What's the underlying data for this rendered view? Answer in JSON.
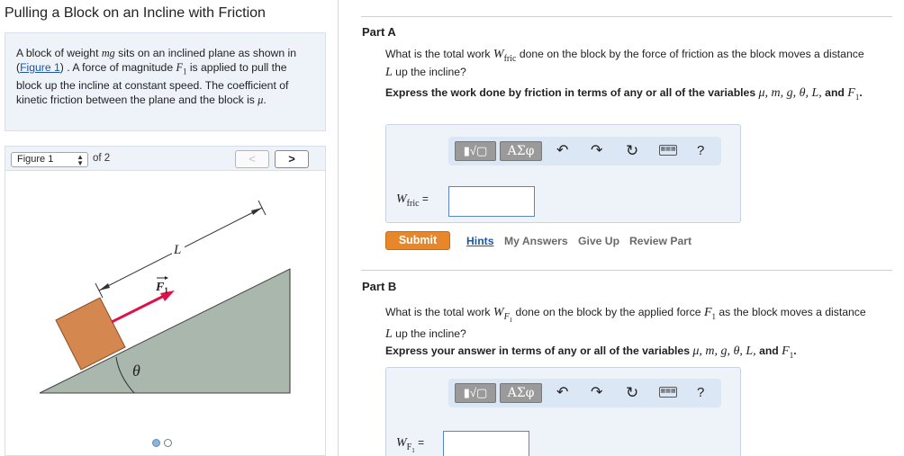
{
  "title": "Pulling a Block on an Incline with Friction",
  "problem": {
    "text_before_link": "A block of weight ",
    "weight_var": "mg",
    "text_mid1": " sits on an inclined plane as shown in (",
    "link": "Figure 1",
    "text_mid2": ") . A force of magnitude ",
    "force_var": "F",
    "force_sub": "1",
    "text_mid3": " is applied to pull the block up the incline at constant speed. The coefficient of kinetic friction between the plane and the block is ",
    "mu_var": "μ",
    "text_end": "."
  },
  "figure_nav": {
    "select_value": "Figure 1",
    "of_label": "of 2",
    "prev": "<",
    "next": ">"
  },
  "figure": {
    "label_L": "L",
    "label_F": "F",
    "label_F_sub": "1",
    "label_theta": "θ",
    "colors": {
      "incline": "#a9b7ad",
      "block": "#d4874f",
      "force": "#e0104a"
    }
  },
  "part_a": {
    "title": "Part A",
    "q1": "What is the total work ",
    "q_var": "W",
    "q_var_sub": "fric",
    "q2": " done on the block by the force of friction as the block moves a distance ",
    "q_L": "L",
    "q3": " up the incline?",
    "instr1": "Express the work done by friction in terms of any or all of the variables ",
    "instr_vars": "μ, m, g, θ, L,",
    "instr_and": " and ",
    "instr_F": "F",
    "instr_F_sub": "1",
    "instr_end": ".",
    "answer_label": "W",
    "answer_sub": "fric",
    "answer_eq": " =",
    "submit": "Submit",
    "hints": "Hints",
    "my_answers": "My Answers",
    "give_up": "Give Up",
    "review": "Review Part"
  },
  "part_b": {
    "title": "Part B",
    "q1": "What is the total work ",
    "q_var": "W",
    "q_var_sub": "F",
    "q_var_subsub": "1",
    "q2": " done on the block by the applied force ",
    "q_F": "F",
    "q_F_sub": "1",
    "q3": " as the block moves a distance ",
    "q_L": "L",
    "q4": " up the incline?",
    "instr1": "Express your answer in terms of any or all of the variables ",
    "instr_vars": "μ, m, g, θ, L,",
    "instr_and": " and ",
    "instr_F": "F",
    "instr_F_sub": "1",
    "instr_end": ".",
    "answer_label": "W",
    "answer_sub": "F",
    "answer_subsub": "1",
    "answer_eq": " ="
  },
  "toolbar": {
    "matrix": "▮√▢",
    "greek": "ΑΣφ",
    "undo": "↶",
    "redo": "↷",
    "reset": "↻",
    "keyboard": "▦▦▦",
    "help": "?"
  }
}
